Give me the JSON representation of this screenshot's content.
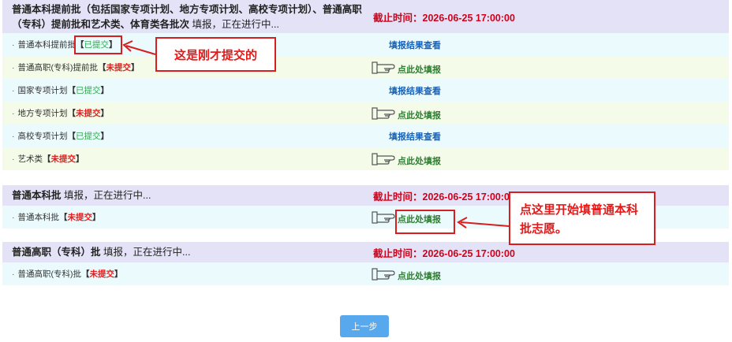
{
  "colors": {
    "header_bg": "#e4e2f6",
    "row_cyan": "#eafafd",
    "row_green": "#f4fbe8",
    "deadline_red": "#d0021b",
    "submitted_green": "#2ea84b",
    "unsubmitted_red": "#e02020",
    "view_link_blue": "#1a62b4",
    "fill_link_green": "#2f7d32",
    "annotation_red": "#d81e1e",
    "button_blue": "#58a8ee"
  },
  "sections": [
    {
      "title": "普通本科提前批（包括国家专项计划、地方专项计划、高校专项计划）、普通高职（专科）提前批和艺术类、体育类各批次",
      "note": "填报，正在进行中...",
      "deadline": "截止时间：2026-06-25 17:00:00",
      "items": [
        {
          "name": "普通本科提前批",
          "status": "已提交",
          "action": "填报结果查看"
        },
        {
          "name": "普通高职(专科)提前批",
          "status": "未提交",
          "action": "点此处填报"
        },
        {
          "name": "国家专项计划",
          "status": "已提交",
          "action": "填报结果查看"
        },
        {
          "name": "地方专项计划",
          "status": "未提交",
          "action": "点此处填报"
        },
        {
          "name": "高校专项计划",
          "status": "已提交",
          "action": "填报结果查看"
        },
        {
          "name": "艺术类",
          "status": "未提交",
          "action": "点此处填报"
        }
      ]
    },
    {
      "title": "普通本科批",
      "note": "填报，正在进行中...",
      "deadline": "截止时间：2026-06-25 17:00:00",
      "items": [
        {
          "name": "普通本科批",
          "status": "未提交",
          "action": "点此处填报"
        }
      ]
    },
    {
      "title": "普通高职（专科）批",
      "note": "填报，正在进行中...",
      "deadline": "截止时间：2026-06-25 17:00:00",
      "items": [
        {
          "name": "普通高职(专科)批",
          "status": "未提交",
          "action": "点此处填报"
        }
      ]
    }
  ],
  "bracket_open": "【",
  "bracket_close": "】",
  "bullet": "·",
  "hand_icon": "pointing-hand-icon",
  "back_button": "上一步",
  "annotations": {
    "submitted_note": "这是刚才提交的",
    "start_note": "点这里开始填普通本科批志愿。"
  }
}
